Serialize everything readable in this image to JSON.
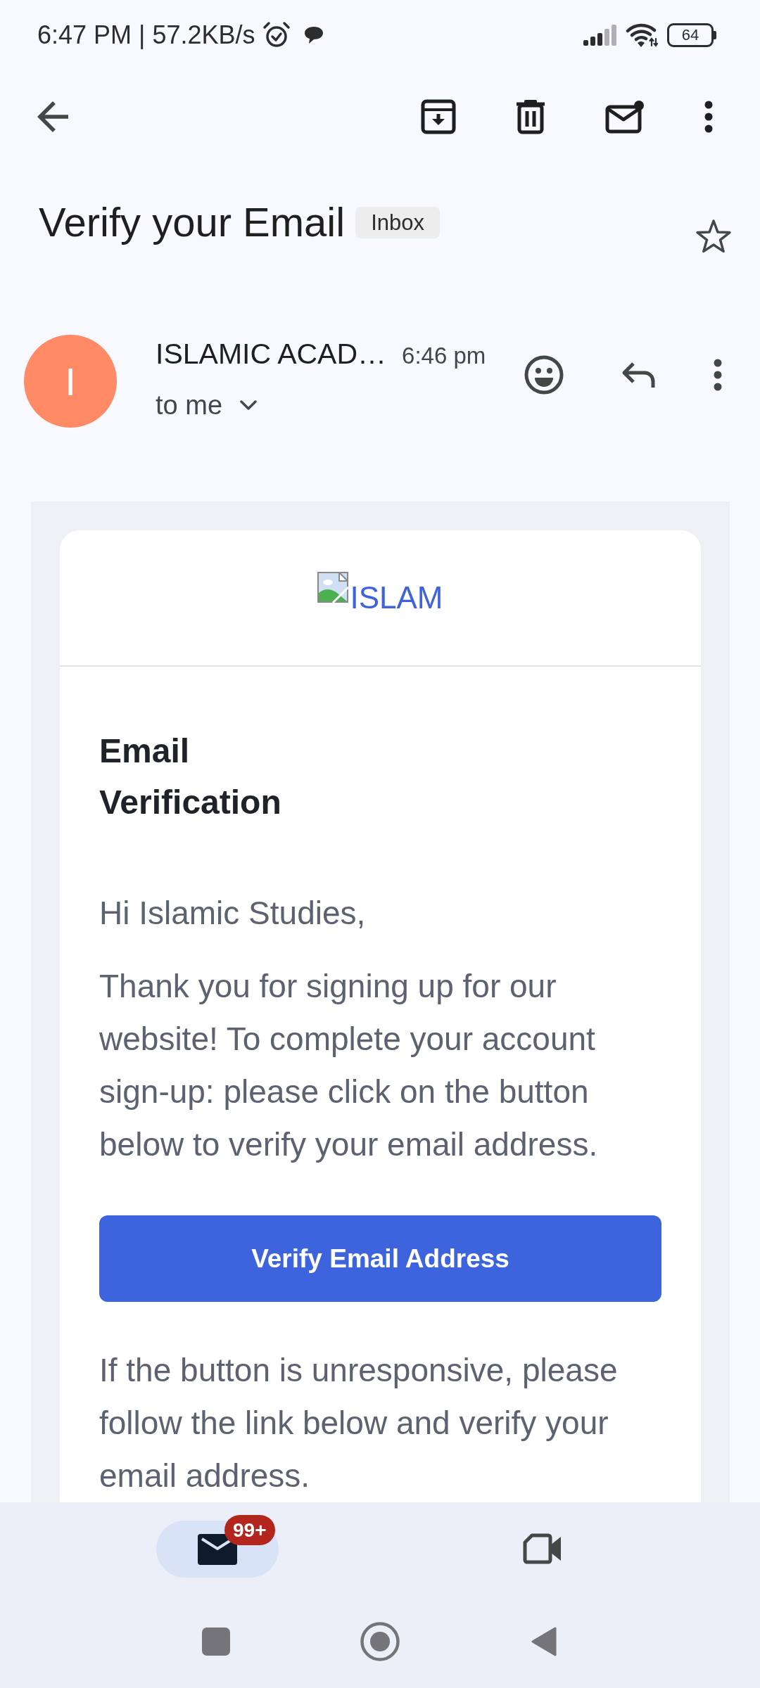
{
  "status_bar": {
    "text": "6:47 PM | 57.2KB/s",
    "battery": "64"
  },
  "subject": {
    "title": "Verify your Email",
    "label": "Inbox",
    "starred": false
  },
  "message": {
    "sender_initial": "I",
    "sender": "ISLAMIC ACAD…",
    "time": "6:46 pm",
    "recipient": "to me"
  },
  "email": {
    "logo_alt": "ISLAM",
    "heading": "Email Verification",
    "greeting": "Hi Islamic Studies,",
    "intro": "Thank you for signing up for our website! To complete your account sign-up: please click on the button below to verify your email address.",
    "button": "Verify Email Address",
    "fallback": "If the button is unresponsive, please follow the link below and verify your email address."
  },
  "bottom_nav": {
    "tabs": [
      {
        "kind": "mail",
        "selected": true,
        "badge": "99+"
      },
      {
        "kind": "video",
        "selected": false
      }
    ]
  }
}
